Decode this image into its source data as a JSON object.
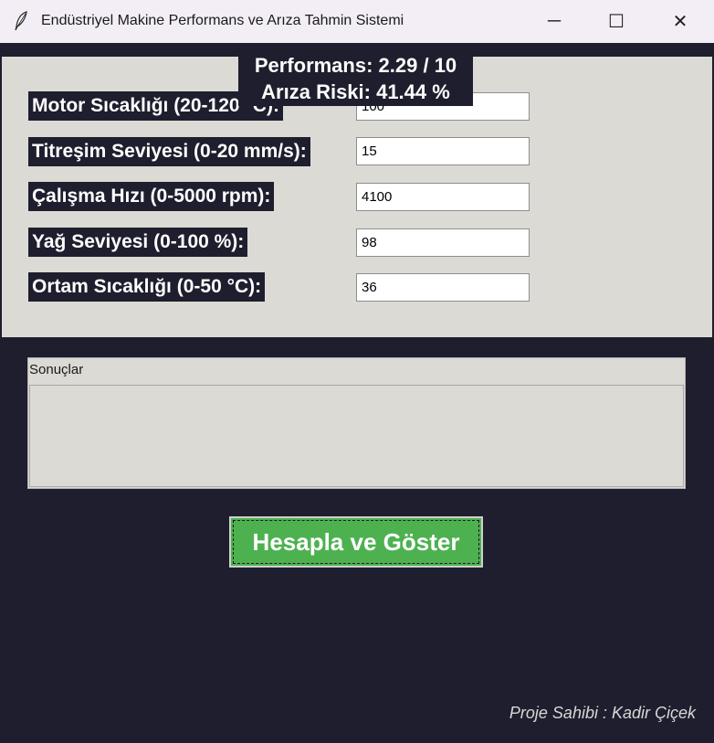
{
  "window": {
    "title": "Endüstriyel Makine Performans ve Arıza Tahmin Sistemi",
    "minimize": "─",
    "maximize": "☐",
    "close": "✕"
  },
  "inputs": [
    {
      "label": "Motor Sıcaklığı (20-120 °C):",
      "value": "100"
    },
    {
      "label": "Titreşim Seviyesi (0-20 mm/s):",
      "value": "15"
    },
    {
      "label": "Çalışma Hızı (0-5000 rpm):",
      "value": "4100"
    },
    {
      "label": "Yağ Seviyesi (0-100 %):",
      "value": "98"
    },
    {
      "label": "Ortam Sıcaklığı (0-50 °C):",
      "value": "36"
    }
  ],
  "results": {
    "title": "Sonuçlar",
    "performance": "Performans: 2.29 / 10",
    "risk": "Arıza Riski: 41.44 %"
  },
  "button": {
    "label": "Hesapla ve Göster",
    "color": "#4db150"
  },
  "footer": "Proje Sahibi : Kadir Çiçek",
  "colors": {
    "background": "#1e1e2e",
    "panel": "#dcdad5"
  }
}
